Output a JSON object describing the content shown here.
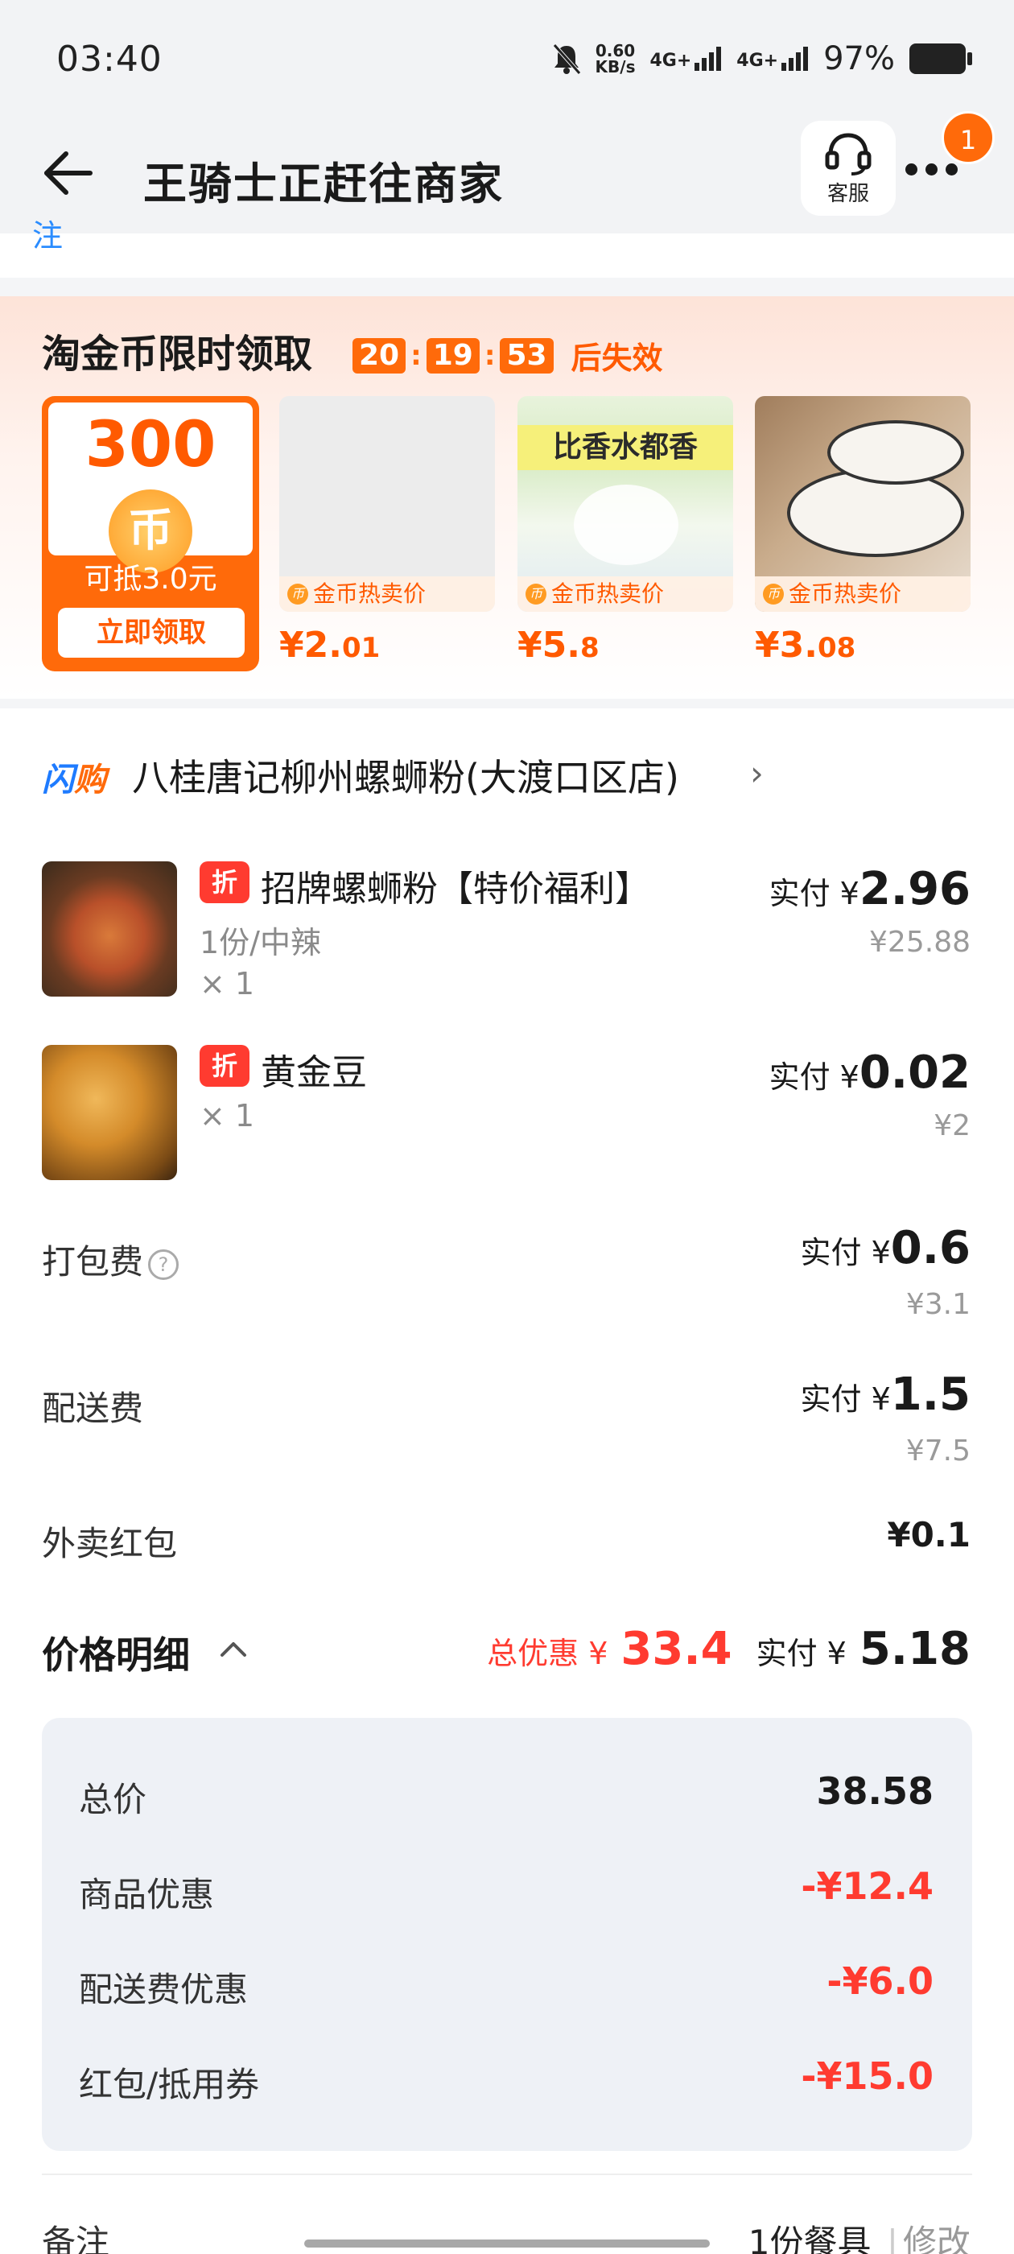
{
  "status_bar": {
    "time": "03:40",
    "net_speed_value": "0.60",
    "net_speed_unit": "KB/s",
    "signal1": "4G+",
    "signal2": "4G+",
    "battery": "97%"
  },
  "header": {
    "title": "王骑士正赶往商家",
    "service_label": "客服",
    "badge_count": "1"
  },
  "top_partial_text": "注",
  "coin_section": {
    "title": "淘金币限时领取",
    "timer": {
      "h": "20",
      "m": "19",
      "s": "53",
      "suffix": "后失效"
    },
    "coin_card": {
      "amount": "300",
      "coin_symbol": "币",
      "offset_text": "可抵3.0元",
      "claim_label": "立即领取"
    },
    "products": [
      {
        "tag": "金币热卖价",
        "price_int": "¥2.",
        "price_dec": "01",
        "image_text": ""
      },
      {
        "tag": "金币热卖价",
        "price_int": "¥5.",
        "price_dec": "8",
        "image_text": "比香水都香"
      },
      {
        "tag": "金币热卖价",
        "price_int": "¥3.",
        "price_dec": "08",
        "image_text": ""
      }
    ]
  },
  "shop": {
    "logo_a": "闪",
    "logo_b": "购",
    "name": "八桂唐记柳州螺蛳粉(大渡口区店)"
  },
  "items": [
    {
      "tag": "折",
      "name": "招牌螺蛳粉【特价福利】",
      "spec": "1份/中辣",
      "qty": "× 1",
      "paid_label": "实付 ¥",
      "paid_value": "2.96",
      "original": "¥25.88"
    },
    {
      "tag": "折",
      "name": "黄金豆",
      "spec": "",
      "qty": "× 1",
      "paid_label": "实付 ¥",
      "paid_value": "0.02",
      "original": "¥2"
    }
  ],
  "fees": {
    "packing": {
      "label": "打包费",
      "paid_label": "实付 ¥",
      "paid_value": "0.6",
      "original": "¥3.1"
    },
    "delivery": {
      "label": "配送费",
      "paid_label": "实付 ¥",
      "paid_value": "1.5",
      "original": "¥7.5"
    },
    "red_packet": {
      "label": "外卖红包",
      "value": "¥0.1"
    }
  },
  "price_detail": {
    "title": "价格明细",
    "total_discount_label": "总优惠 ¥",
    "total_discount_value": "33.4",
    "paid_label": "实付 ¥",
    "paid_value": "5.18",
    "rows": [
      {
        "label": "总价",
        "value": "38.58"
      },
      {
        "label": "商品优惠",
        "value": "-¥12.4"
      },
      {
        "label": "配送费优惠",
        "value": "-¥6.0"
      },
      {
        "label": "红包/抵用券",
        "value": "-¥15.0"
      }
    ]
  },
  "remark": {
    "label": "备注",
    "value": "1份餐具",
    "edit": "修改"
  }
}
